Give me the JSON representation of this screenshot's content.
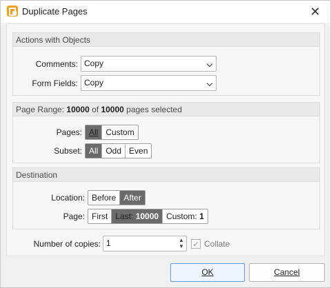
{
  "window": {
    "title": "Duplicate Pages"
  },
  "actions": {
    "header": "Actions with Objects",
    "comments_label": "Comments:",
    "comments_value": "Copy",
    "form_fields_label": "Form Fields:",
    "form_fields_value": "Copy"
  },
  "page_range": {
    "header_prefix": "Page Range: ",
    "selected": "10000",
    "of": " of ",
    "total": "10000",
    "suffix": " pages selected",
    "pages_label": "Pages:",
    "pages_options": [
      "All",
      "Custom"
    ],
    "pages_selected": "All",
    "subset_label": "Subset:",
    "subset_options": [
      "All",
      "Odd",
      "Even"
    ],
    "subset_selected": "All"
  },
  "destination": {
    "header": "Destination",
    "location_label": "Location:",
    "location_options": [
      "Before",
      "After"
    ],
    "location_selected": "After",
    "page_label": "Page:",
    "page_first": "First",
    "page_last_prefix": "Last: ",
    "page_last_value": "10000",
    "page_custom_prefix": "Custom: ",
    "page_custom_value": "1"
  },
  "copies": {
    "label": "Number of copies:",
    "value": "1",
    "collate_label": "Collate",
    "collate_checked": true
  },
  "buttons": {
    "ok": "OK",
    "cancel": "Cancel"
  },
  "colors": {
    "accent": "#5c9be0",
    "selected_segment": "#6b6b6b",
    "brand": "#f0a21c"
  }
}
